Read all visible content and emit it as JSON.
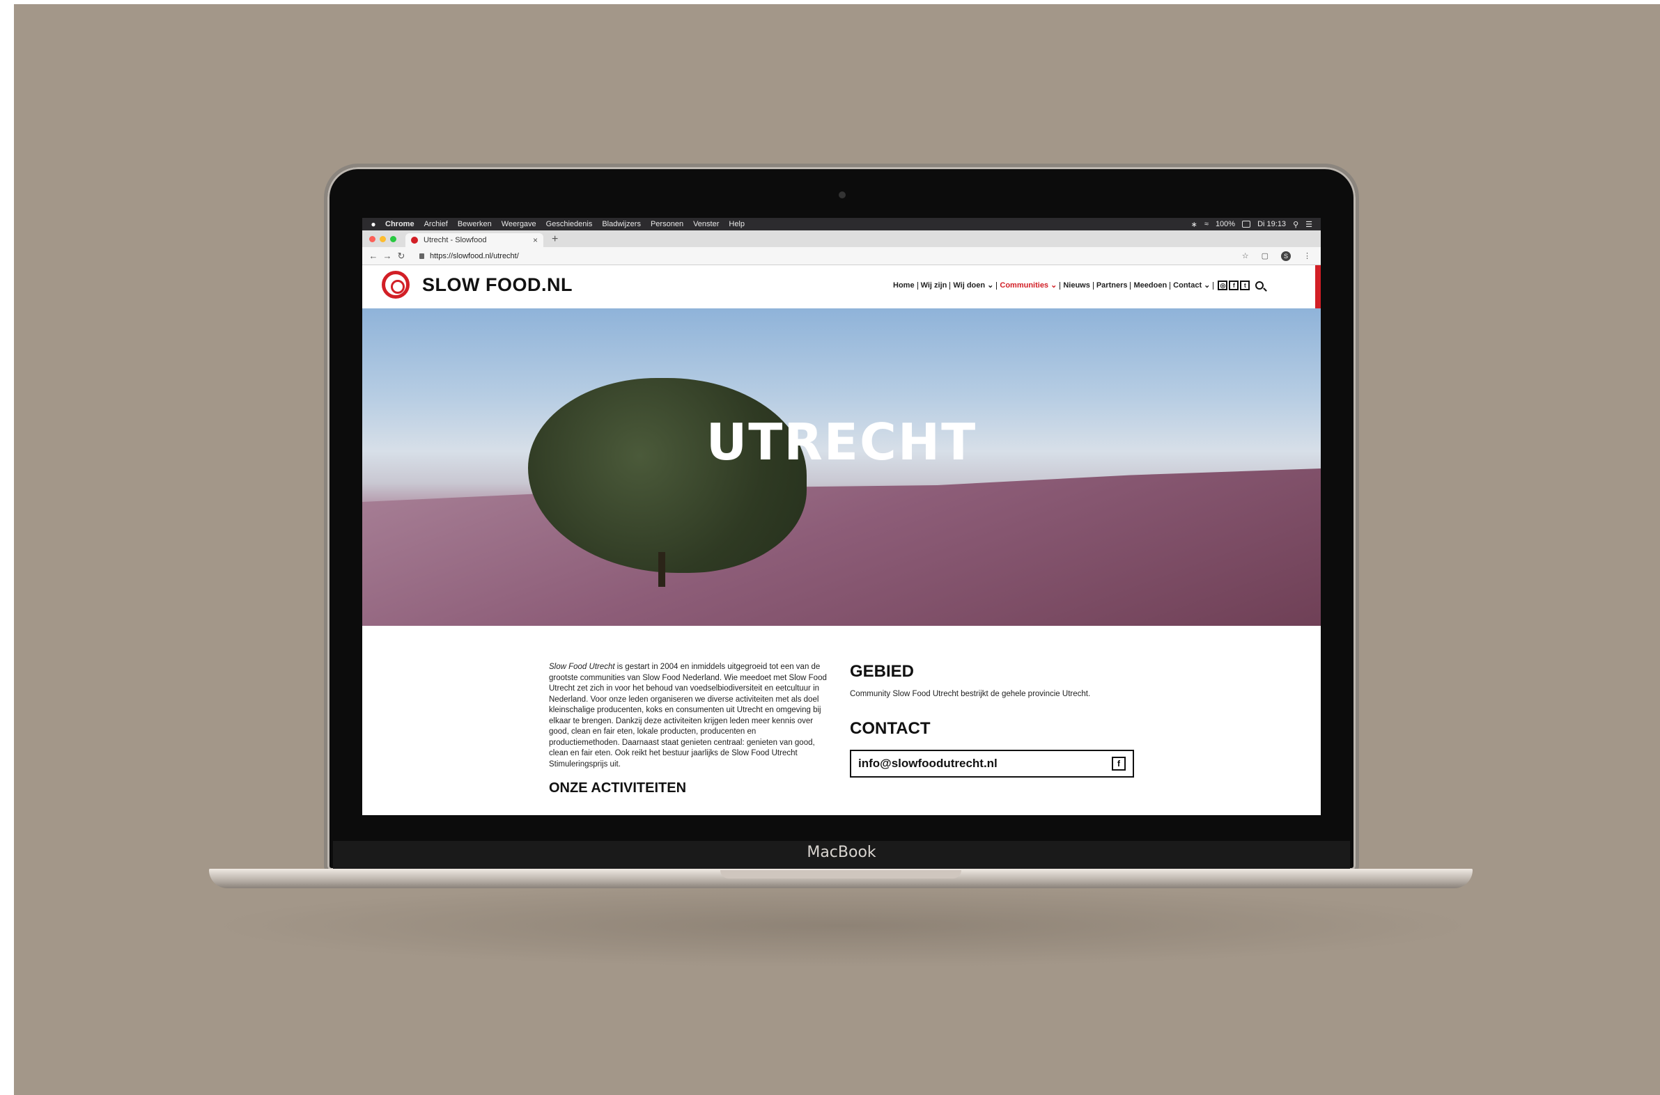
{
  "menubar": {
    "apple": "",
    "items": [
      "Chrome",
      "Archief",
      "Bewerken",
      "Weergave",
      "Geschiedenis",
      "Bladwijzers",
      "Personen",
      "Venster",
      "Help"
    ],
    "battery": "100%",
    "clock": "Di 19:13"
  },
  "browser": {
    "tab_title": "Utrecht - Slowfood",
    "tab_close": "×",
    "new_tab": "+",
    "url": "https://slowfood.nl/utrecht/",
    "profile_initial": "S"
  },
  "site": {
    "logo_text": "SLOW FOOD.NL",
    "nav": [
      {
        "label": "Home",
        "active": false
      },
      {
        "label": "Wij zijn",
        "active": false
      },
      {
        "label": "Wij doen ⌄",
        "active": false
      },
      {
        "label": "Communities ⌄",
        "active": true
      },
      {
        "label": "Nieuws",
        "active": false
      },
      {
        "label": "Partners",
        "active": false
      },
      {
        "label": "Meedoen",
        "active": false
      },
      {
        "label": "Contact ⌄",
        "active": false
      }
    ],
    "social": [
      "◎",
      "f",
      "t"
    ],
    "hero_title": "UTRECHT",
    "about_italic": "Slow Food Utrecht",
    "about_text": " is gestart in 2004 en inmiddels uitgegroeid tot een van de grootste communities van Slow Food Nederland. Wie meedoet met Slow Food Utrecht zet zich in voor het behoud van voedselbiodiversiteit en eetcultuur in Nederland.  Voor onze leden organiseren we diverse activiteiten met als doel kleinschalige producenten, koks en consumenten uit Utrecht en omgeving bij elkaar te brengen. Dankzij deze activiteiten krijgen leden meer kennis over good, clean en fair eten, lokale producten, producenten en productiemethoden. Daarnaast staat genieten centraal: genieten van good, clean en fair eten. Ook reikt het bestuur jaarlijks de Slow Food Utrecht Stimuleringsprijs uit.",
    "activities_heading": "ONZE ACTIVITEITEN",
    "gebied_heading": "GEBIED",
    "gebied_text": "Community Slow Food Utrecht bestrijkt de gehele provincie Utrecht.",
    "contact_heading": "CONTACT",
    "contact_email": "info@slowfoodutrecht.nl",
    "contact_fb": "f"
  },
  "device": {
    "label": "MacBook"
  },
  "colors": {
    "brand_red": "#d21f26",
    "backdrop": "#a39789"
  }
}
